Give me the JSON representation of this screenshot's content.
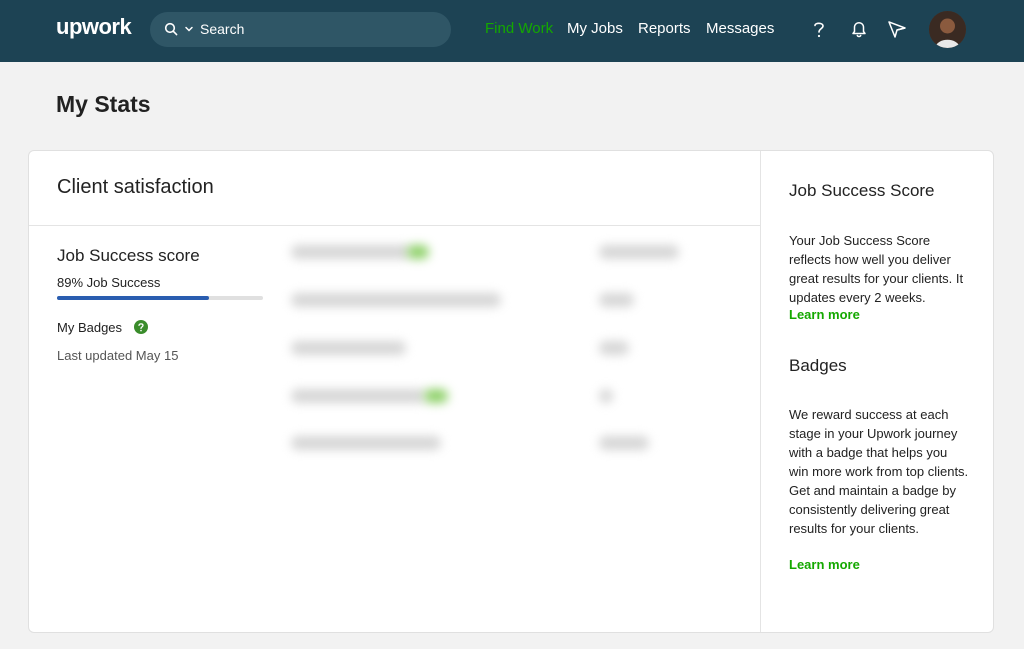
{
  "nav": {
    "logo": "upwork",
    "search_label": "Search",
    "links": [
      "Find Work",
      "My Jobs",
      "Reports",
      "Messages"
    ],
    "active_link": "Find Work",
    "accent_color": "#14a800",
    "bar_color": "#1d4354"
  },
  "page": {
    "title": "My Stats"
  },
  "client_satisfaction": {
    "title": "Client satisfaction",
    "jss_title": "Job Success score",
    "jss_value": "89% Job Success",
    "jss_progress": 0.89,
    "badges_label": "My Badges",
    "last_updated": "Last updated May 15"
  },
  "sidebar": {
    "jss_heading": "Job Success Score",
    "jss_text": "Your Job Success Score reflects how well you deliver great results for your clients. It updates every 2 weeks.",
    "jss_link": "Learn more",
    "badges_heading": "Badges",
    "badges_text": "We reward success at each stage in your Upwork journey with a badge that helps you win more work from top clients. Get and maintain a badge by consistently delivering great results for your clients.",
    "badges_link": "Learn more"
  }
}
